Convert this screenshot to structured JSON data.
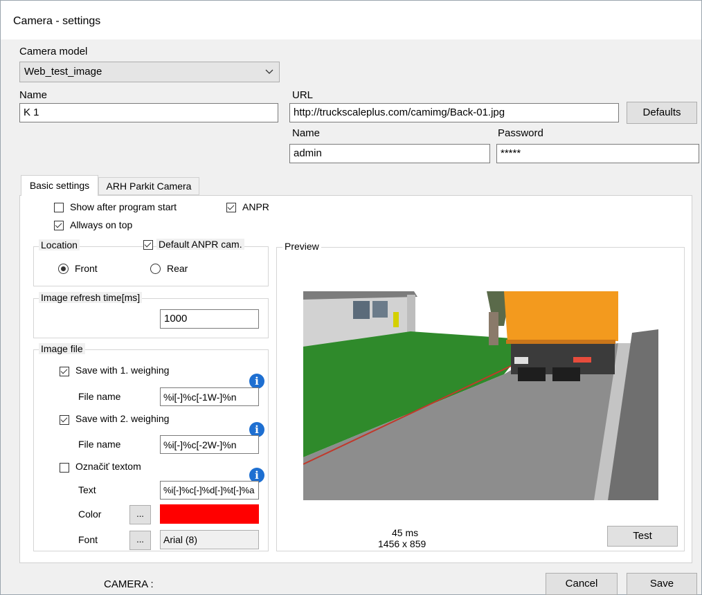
{
  "window": {
    "title": "Camera - settings"
  },
  "camera_model": {
    "label": "Camera model",
    "value": "Web_test_image"
  },
  "name": {
    "label": "Name",
    "value": "K 1"
  },
  "url": {
    "label": "URL",
    "value": "http://truckscaleplus.com/camimg/Back-01.jpg",
    "defaults_label": "Defaults"
  },
  "credentials": {
    "name_label": "Name",
    "name_value": "admin",
    "password_label": "Password",
    "password_value": "*****"
  },
  "tabs": [
    {
      "label": "Basic settings",
      "active": true
    },
    {
      "label": "ARH Parkit Camera",
      "active": false
    }
  ],
  "options": {
    "show_after_start": {
      "label": "Show after program start",
      "checked": false
    },
    "anpr": {
      "label": "ANPR",
      "checked": true
    },
    "always_on_top": {
      "label": "Allways on top",
      "checked": true
    }
  },
  "location": {
    "legend": "Location",
    "default_anpr": {
      "label": "Default ANPR cam.",
      "checked": true
    },
    "front_label": "Front",
    "rear_label": "Rear",
    "selected": "Front"
  },
  "refresh": {
    "legend": "Image refresh time[ms]",
    "value": "1000"
  },
  "image_file": {
    "legend": "Image file",
    "save1": {
      "label": "Save with 1. weighing",
      "checked": true,
      "file_label": "File name",
      "file_value": "%i[-]%c[-1W-]%n"
    },
    "save2": {
      "label": "Save with 2. weighing",
      "checked": true,
      "file_label": "File name",
      "file_value": "%i[-]%c[-2W-]%n"
    },
    "mark_text": {
      "label": "Označiť textom",
      "checked": false,
      "text_label": "Text",
      "text_value": "%i[-]%c[-]%d[-]%t[-]%a"
    },
    "color": {
      "label": "Color",
      "value": "#ff0000"
    },
    "font": {
      "label": "Font",
      "value": "Arial (8)"
    },
    "ellipsis": "..."
  },
  "preview": {
    "legend": "Preview",
    "time": "45 ms",
    "resolution": "1456 x 859",
    "test_label": "Test"
  },
  "footer": {
    "status": "CAMERA :",
    "cancel_label": "Cancel",
    "save_label": "Save"
  },
  "colors": {
    "window_bg": "#f0f0f0",
    "info_blue": "#1e6fd1",
    "grass": "#2f8a2b",
    "truck_orange": "#f39a1e"
  }
}
